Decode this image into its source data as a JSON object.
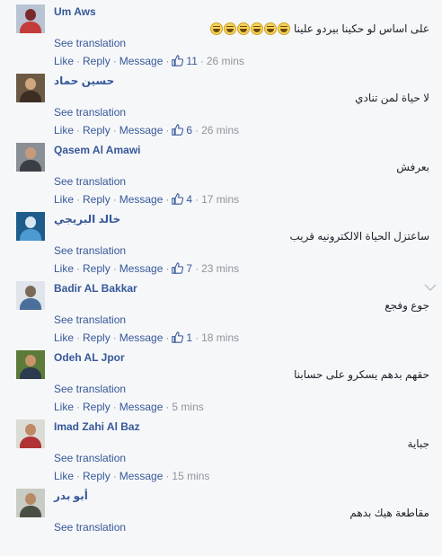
{
  "comments": [
    {
      "name": "Um Aws",
      "text": "على اساس لو حكينا بيردو علينا",
      "emojis": [
        "grin-emoji",
        "grin-emoji",
        "grin-emoji",
        "grin-emoji",
        "grin-emoji",
        "grin-emoji"
      ],
      "translate": "See translation",
      "like": "Like",
      "reply": "Reply",
      "message": "Message",
      "likes": "11",
      "time": "26 mins",
      "avatar_colors": [
        "#b8c4d4",
        "#7a2a2a",
        "#c43b3b"
      ]
    },
    {
      "name": "حسين حماد",
      "text": "لا حياة لمن تنادي",
      "translate": "See translation",
      "like": "Like",
      "reply": "Reply",
      "message": "Message",
      "likes": "6",
      "time": "26 mins",
      "avatar_colors": [
        "#6d5a45",
        "#d0a77e",
        "#3c2e23"
      ]
    },
    {
      "name": "Qasem Al Amawi",
      "text": "بعرفش",
      "translate": "See translation",
      "like": "Like",
      "reply": "Reply",
      "message": "Message",
      "likes": "4",
      "time": "17 mins",
      "avatar_colors": [
        "#8a8f96",
        "#c79a7c",
        "#3b3e45"
      ]
    },
    {
      "name": "خالد البريجي",
      "text": "ساعتزل الحياة الالكترونيه قريب",
      "translate": "See translation",
      "like": "Like",
      "reply": "Reply",
      "message": "Message",
      "likes": "7",
      "time": "23 mins",
      "avatar_colors": [
        "#1e5c8c",
        "#d6e6f2",
        "#4c9ad0"
      ]
    },
    {
      "name": "Badir AL Bakkar",
      "text": "جوع وفجع",
      "translate": "See translation",
      "like": "Like",
      "reply": "Reply",
      "message": "Message",
      "likes": "1",
      "time": "18 mins",
      "avatar_colors": [
        "#dfe5ea",
        "#7c6a58",
        "#4a6f9a"
      ]
    },
    {
      "name": "Odeh AL Jpor",
      "text": "حقهم بدهم يسكرو على حسابنا",
      "translate": "See translation",
      "like": "Like",
      "reply": "Reply",
      "message": "Message",
      "likes": "",
      "time": "5 mins",
      "avatar_colors": [
        "#5c7a3a",
        "#c9946a",
        "#2d3b4f"
      ]
    },
    {
      "name": "Imad Zahi Al Baz",
      "text": "جباية",
      "translate": "See translation",
      "like": "Like",
      "reply": "Reply",
      "message": "Message",
      "likes": "",
      "time": "15 mins",
      "avatar_colors": [
        "#dcdcd6",
        "#c08864",
        "#b03434"
      ]
    },
    {
      "name": "أبو بدر",
      "text": "مقاطعة هيك بدهم",
      "translate": "See translation",
      "like": "",
      "reply": "",
      "message": "",
      "likes": "",
      "time": "",
      "avatar_colors": [
        "#c9ccc4",
        "#b88a66",
        "#4a4f45"
      ]
    }
  ],
  "colors": {
    "link": "#365899",
    "meta": "#90949c",
    "text": "#1d2129",
    "bg": "#f6f7f9"
  }
}
